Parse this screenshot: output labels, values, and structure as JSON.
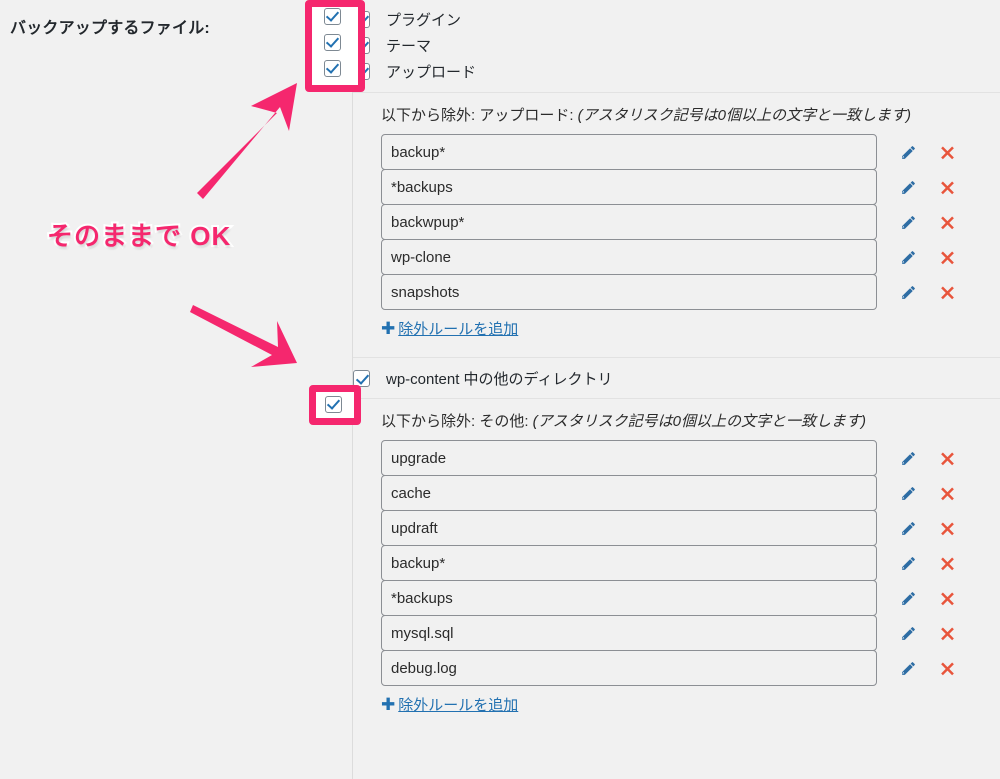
{
  "page": {
    "field_label": "バックアップするファイル:",
    "background_color": "#f1f1f1",
    "accent_pink": "#f5276e",
    "link_blue": "#2271b1",
    "pencil_blue": "#2e6da4",
    "delete_red": "#e8553c"
  },
  "backup_targets": {
    "checkboxes": [
      {
        "label": "プラグイン",
        "checked": true
      },
      {
        "label": "テーマ",
        "checked": true
      },
      {
        "label": "アップロード",
        "checked": true
      }
    ]
  },
  "uploads_exclude": {
    "heading_normal": "以下から除外: アップロード: ",
    "heading_italic": "(アスタリスク記号は0個以上の文字と一致します)",
    "rules": [
      "backup*",
      "*backups",
      "backwpup*",
      "wp-clone",
      "snapshots"
    ],
    "add_label": "除外ルールを追加",
    "add_plus": "✚",
    "edit_icon": "pencil-icon",
    "delete_icon": "x-icon"
  },
  "wpcontent_others": {
    "checkbox": {
      "label": "wp-content 中の他のディレクトリ",
      "checked": true
    }
  },
  "others_exclude": {
    "heading_normal": "以下から除外: その他: ",
    "heading_italic": "(アスタリスク記号は0個以上の文字と一致します)",
    "rules": [
      "upgrade",
      "cache",
      "updraft",
      "backup*",
      "*backups",
      "mysql.sql",
      "debug.log"
    ],
    "add_label": "除外ルールを追加",
    "add_plus": "✚"
  },
  "annotations": {
    "ok_text": "そのままで OK",
    "arrows": [
      {
        "name": "arrow-up-right",
        "direction": "up-right"
      },
      {
        "name": "arrow-down-right",
        "direction": "down-right"
      }
    ],
    "highlights": [
      {
        "name": "highlight-backup-targets-checkboxes"
      },
      {
        "name": "highlight-wpcontent-checkbox"
      }
    ]
  }
}
